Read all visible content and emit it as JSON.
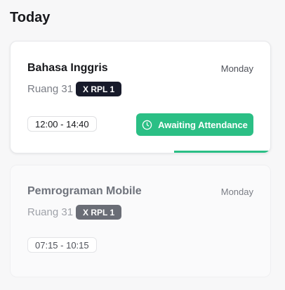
{
  "section": {
    "title": "Today"
  },
  "schedule": [
    {
      "subject": "Bahasa Inggris",
      "day": "Monday",
      "room": "Ruang 31",
      "class": "X RPL 1",
      "time": "12:00 - 14:40",
      "status_label": "Awaiting Attendance",
      "status_icon": "clock-icon",
      "progress_percent": 37
    },
    {
      "subject": "Pemrograman Mobile",
      "day": "Monday",
      "room": "Ruang 31",
      "class": "X RPL 1",
      "time": "07:15 - 10:15"
    }
  ],
  "colors": {
    "accent": "#2bbf85",
    "badge_active": "#171a2a",
    "badge_inactive": "#6a6d76"
  }
}
